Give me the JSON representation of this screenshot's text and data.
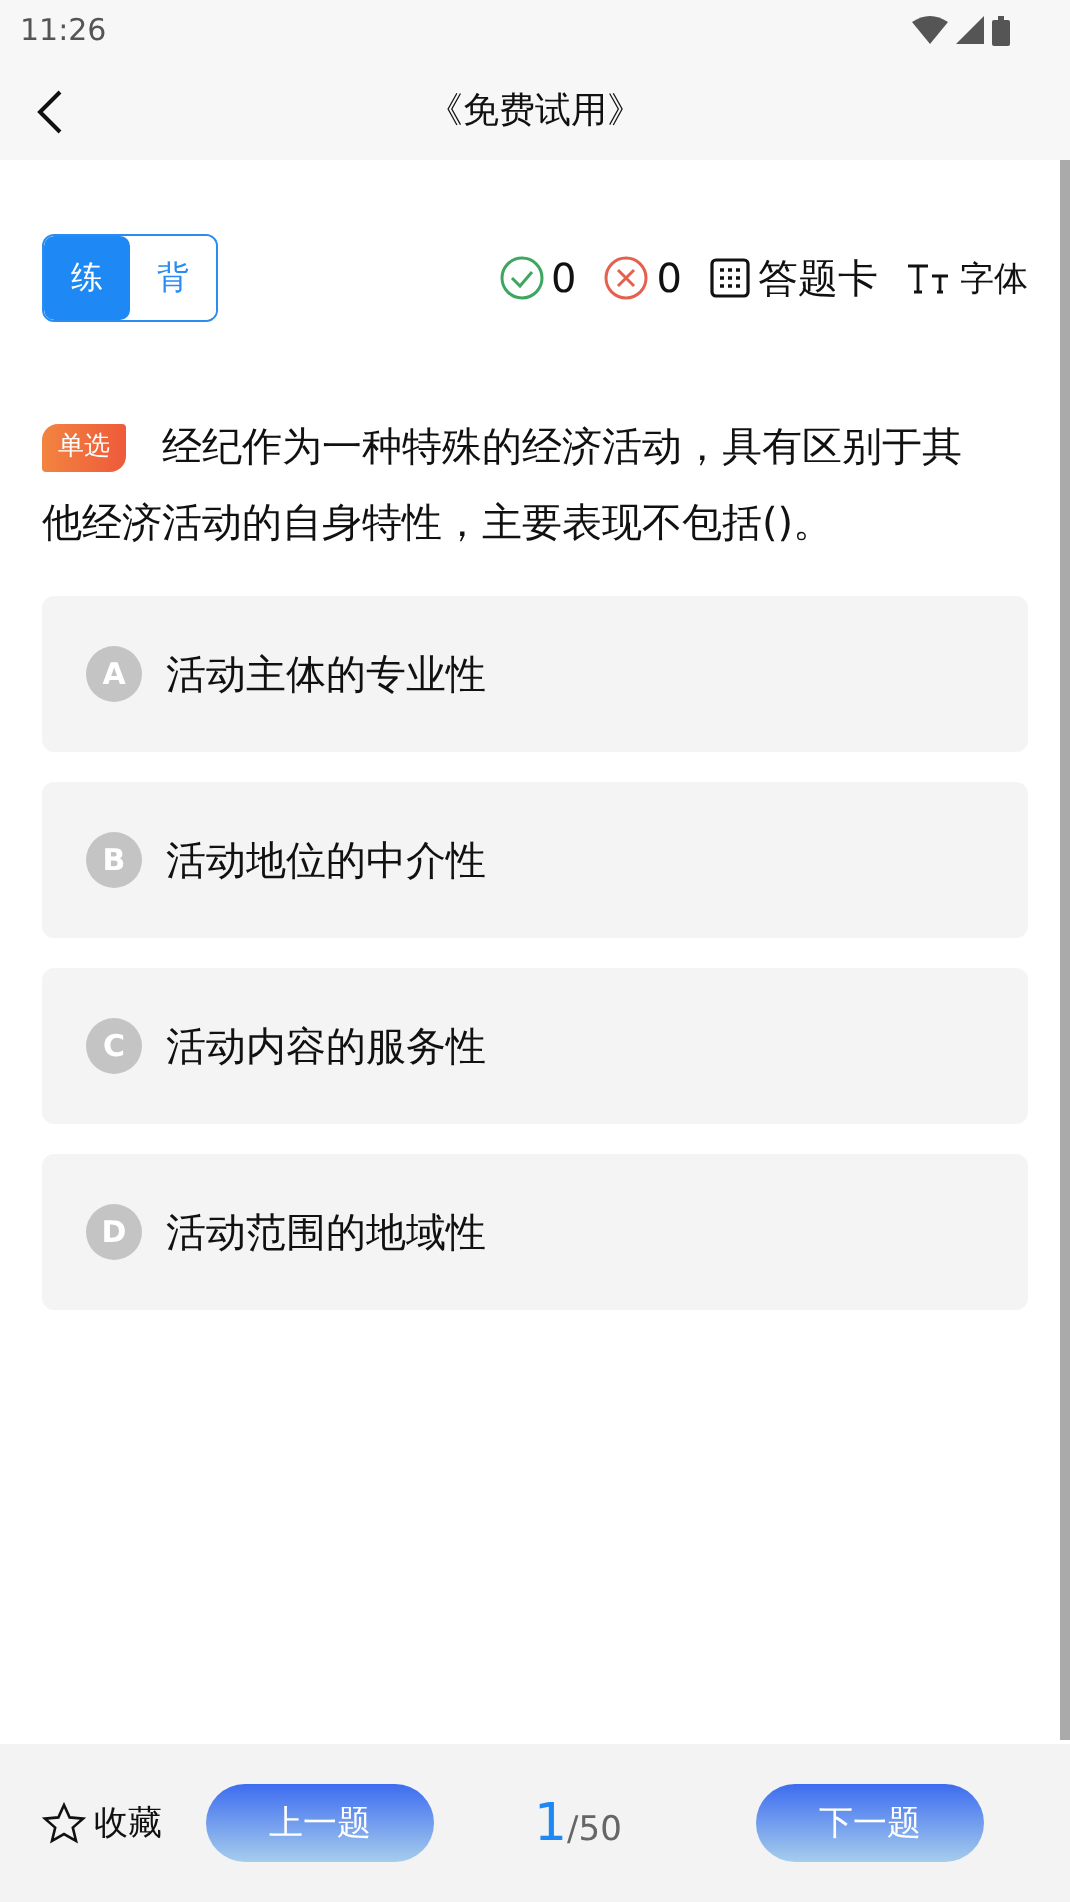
{
  "status_bar": {
    "time": "11:26"
  },
  "header": {
    "title": "《免费试用》"
  },
  "mode_tabs": [
    {
      "label": "练",
      "selected": true
    },
    {
      "label": "背",
      "selected": false
    }
  ],
  "stats": {
    "correct": "0",
    "wrong": "0",
    "answer_card": "答题卡",
    "font_label": "字体"
  },
  "question": {
    "type_badge": "单选",
    "text": "经纪作为一种特殊的经济活动，具有区别于其他经济活动的自身特性，主要表现不包括()。",
    "options": [
      {
        "letter": "A",
        "text": "活动主体的专业性"
      },
      {
        "letter": "B",
        "text": "活动地位的中介性"
      },
      {
        "letter": "C",
        "text": "活动内容的服务性"
      },
      {
        "letter": "D",
        "text": "活动范围的地域性"
      }
    ]
  },
  "footer": {
    "favorite": "收藏",
    "prev": "上一题",
    "current": "1",
    "total": "/50",
    "next": "下一题"
  }
}
